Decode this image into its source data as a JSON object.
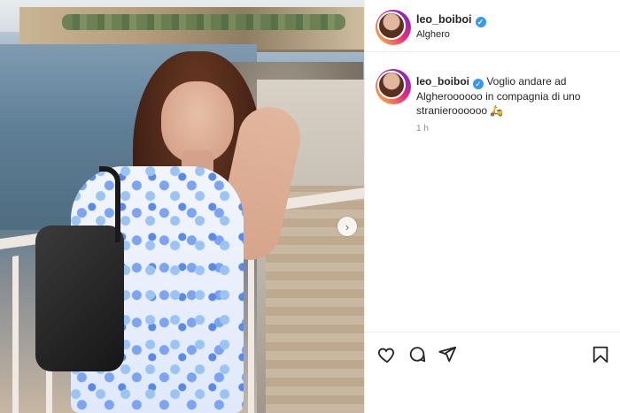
{
  "post": {
    "username": "leo_boiboi",
    "location": "Alghero",
    "caption_username": "leo_boiboi",
    "caption": "Voglio andare ad Algheroooooo in compagnia di uno stranieroooooo",
    "emoji": "🛵",
    "time": "1 h"
  },
  "icons": {
    "verified": "verified-badge",
    "next": "chevron-right",
    "like": "heart",
    "comment": "speech-bubble",
    "share": "paper-plane",
    "save": "bookmark"
  },
  "glyphs": {
    "check": "✓",
    "next": "›"
  },
  "colors": {
    "verified": "#3897f0",
    "story_ring_start": "#f9ce34",
    "story_ring_end": "#6228d7",
    "text": "#262626",
    "muted": "#8e8e8e"
  }
}
